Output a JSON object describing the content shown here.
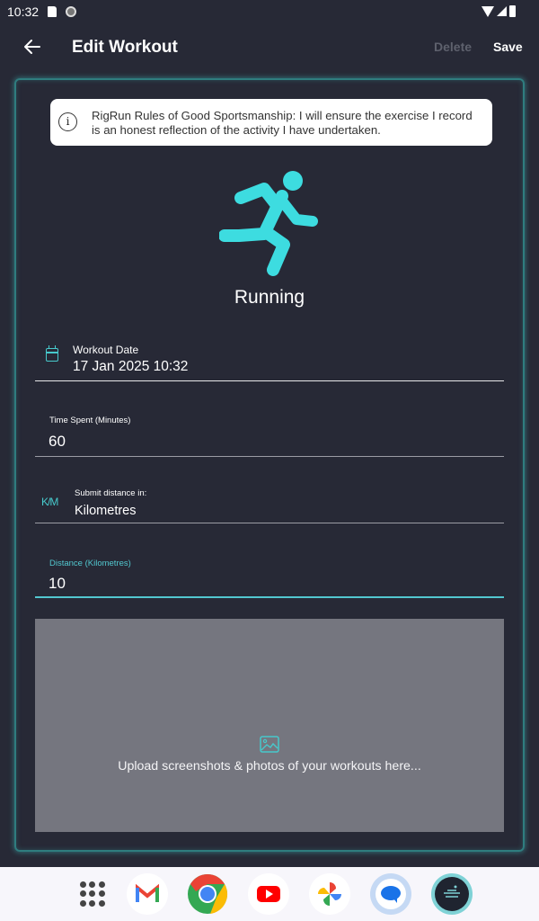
{
  "status_bar": {
    "time": "10:32"
  },
  "app_bar": {
    "title": "Edit Workout",
    "delete_label": "Delete",
    "save_label": "Save"
  },
  "notice": {
    "text": "RigRun Rules of Good Sportsmanship: I will ensure the exercise I record is an honest reflection of the activity I have undertaken."
  },
  "activity": {
    "icon": "running-icon",
    "name": "Running",
    "accent_color": "#3ddce0"
  },
  "fields": {
    "workout_date": {
      "label": "Workout Date",
      "value": "17 Jan 2025 10:32"
    },
    "time_spent": {
      "label": "Time Spent (Minutes)",
      "value": "60"
    },
    "distance_unit": {
      "icon_text": "K/M",
      "label": "Submit distance in:",
      "value": "Kilometres"
    },
    "distance": {
      "label": "Distance (Kilometres)",
      "value": "10"
    }
  },
  "upload": {
    "text": "Upload screenshots & photos of your workouts here..."
  },
  "dock": {
    "items": [
      "app-drawer",
      "gmail",
      "chrome",
      "youtube",
      "photos",
      "messages",
      "rigrun"
    ]
  }
}
